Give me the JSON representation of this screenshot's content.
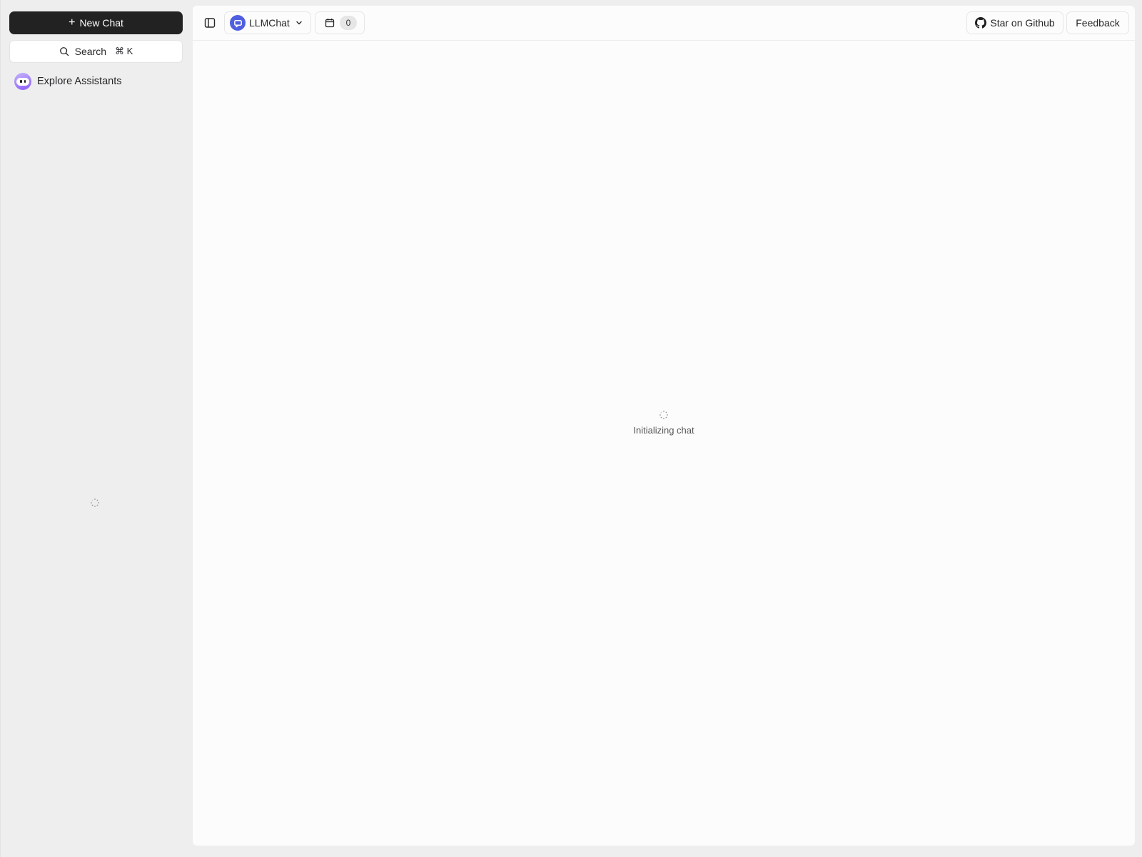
{
  "sidebar": {
    "new_chat_label": "New Chat",
    "search_label": "Search",
    "search_shortcut": "⌘ K",
    "items": [
      {
        "label": "Explore Assistants",
        "icon": "bot-avatar-icon"
      }
    ],
    "loading": true
  },
  "header": {
    "model_name": "LLMChat",
    "calendar_count": "0",
    "github_label": "Star on Github",
    "feedback_label": "Feedback"
  },
  "main": {
    "status_text": "Initializing chat"
  },
  "colors": {
    "new_chat_bg": "#222222",
    "model_logo": "#4f5fe0",
    "assistant_avatar": "#8b5cf6"
  }
}
